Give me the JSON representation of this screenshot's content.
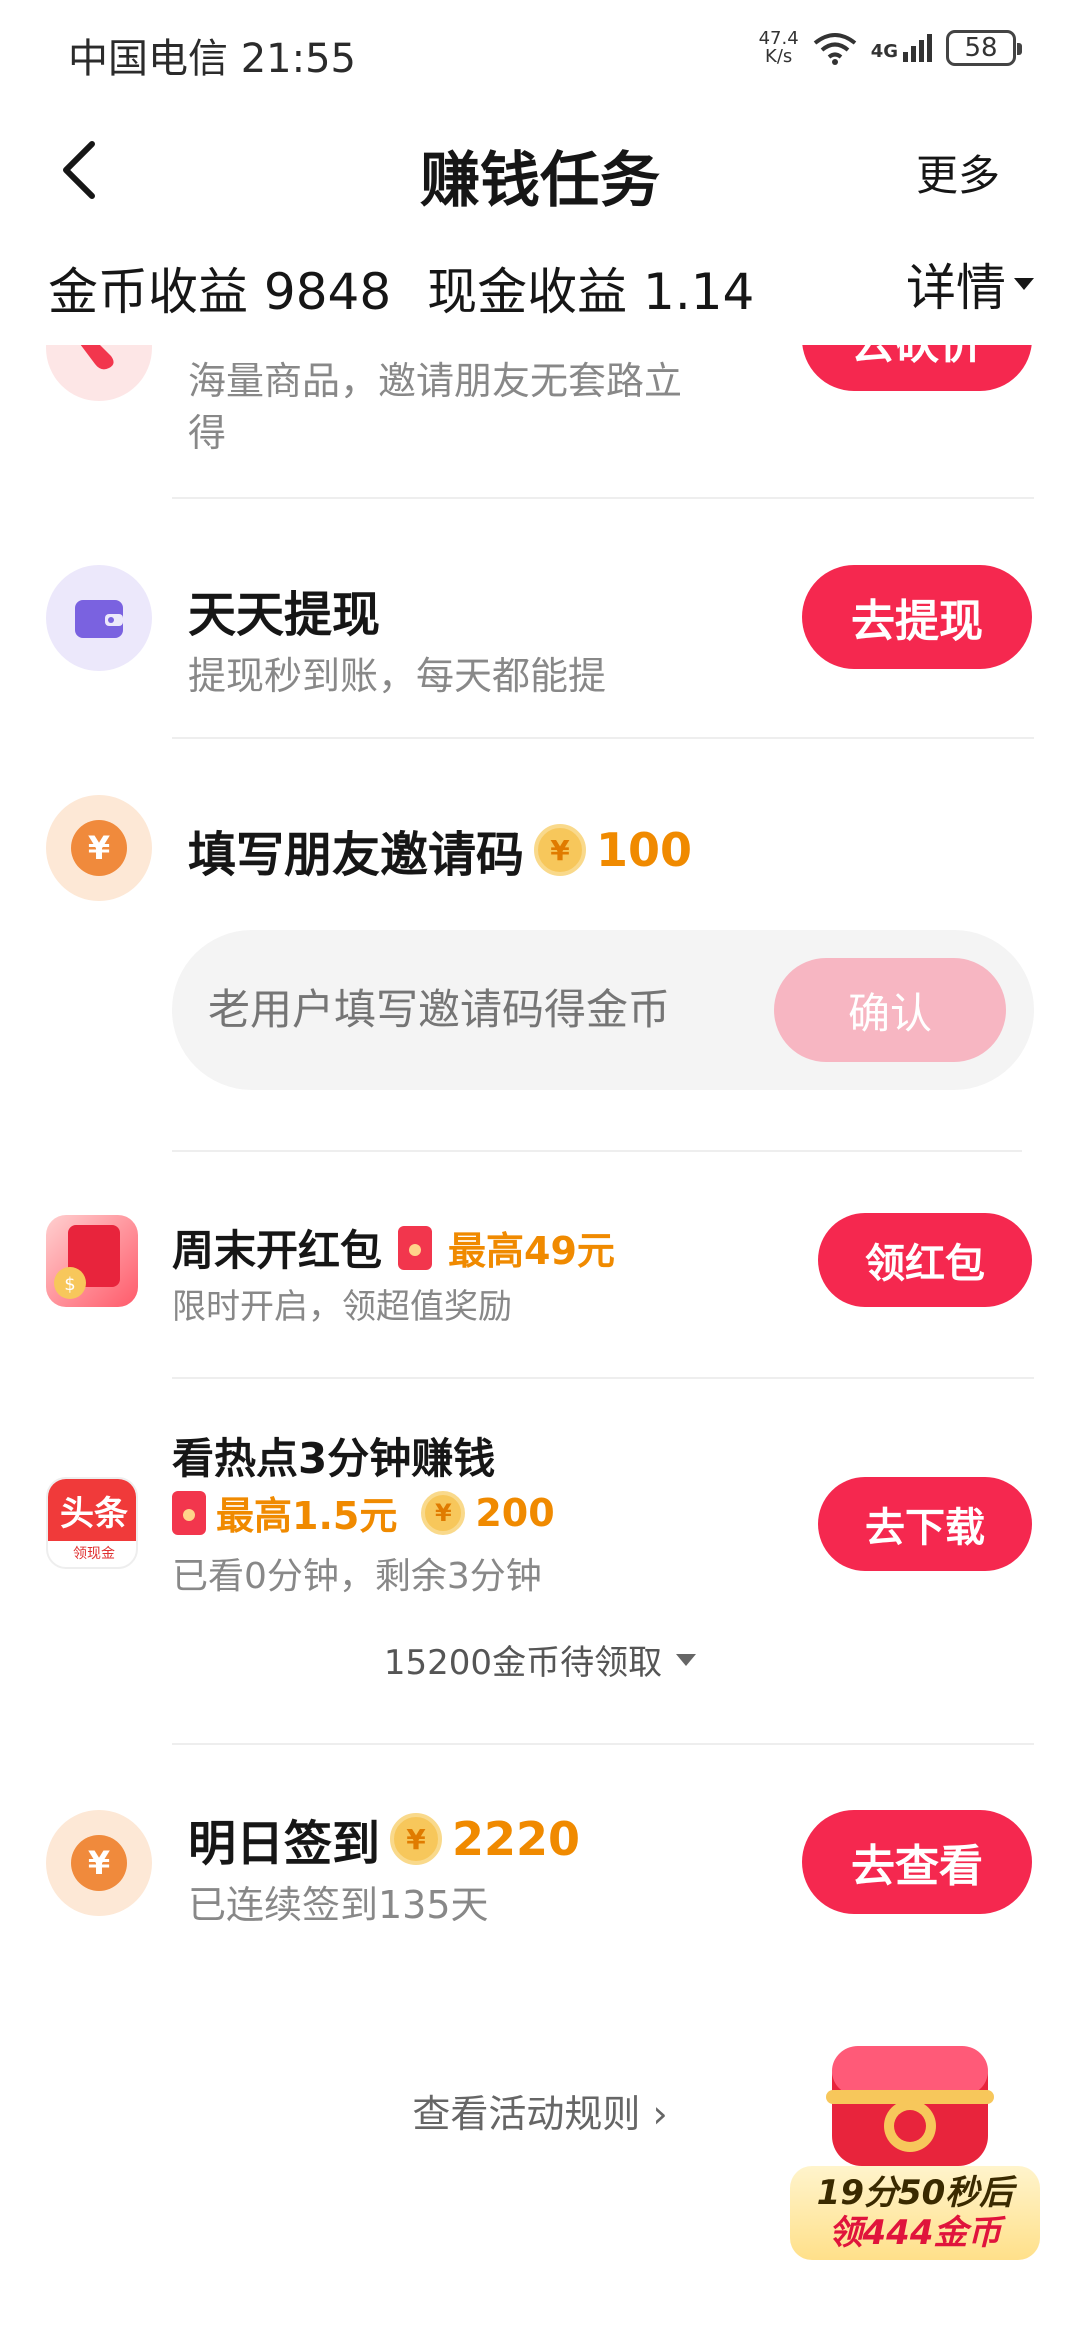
{
  "status_bar": {
    "carrier_time": "中国电信 21:55",
    "net_speed_value": "47.4",
    "net_speed_unit": "K/s",
    "network_type": "4G",
    "battery": "58"
  },
  "header": {
    "title": "赚钱任务",
    "more_label": "更多"
  },
  "earnings": {
    "coin_label": "金币收益 9848",
    "cash_label": "现金收益 1.14",
    "details_label": "详情"
  },
  "tasks": {
    "bargain": {
      "subtitle_line1": "海量商品，邀请朋友无套路立",
      "subtitle_line2": "得",
      "button": "去砍价"
    },
    "withdraw": {
      "title": "天天提现",
      "subtitle": "提现秒到账，每天都能提",
      "button": "去提现"
    },
    "invite_code": {
      "title": "填写朋友邀请码",
      "reward": "100",
      "placeholder": "老用户填写邀请码得金币",
      "confirm": "确认"
    },
    "weekend_redpack": {
      "title": "周末开红包",
      "reward": "最高49元",
      "subtitle": "限时开启，领超值奖励",
      "button": "领红包"
    },
    "hot_news": {
      "title": "看热点3分钟赚钱",
      "cash_reward": "最高1.5元",
      "coin_reward": "200",
      "subtitle": "已看0分钟，剩余3分钟",
      "app_icon_text": "头条",
      "app_icon_sub": "领现金",
      "button": "去下载",
      "pending": "15200金币待领取"
    },
    "checkin": {
      "title": "明日签到",
      "reward": "2220",
      "subtitle": "已连续签到135天",
      "button": "去查看"
    }
  },
  "rules_link": "查看活动规则",
  "chest": {
    "timer": "19分50秒后",
    "reward": "领444金币"
  },
  "colors": {
    "accent": "#f5284f",
    "coin": "#f08a00"
  }
}
